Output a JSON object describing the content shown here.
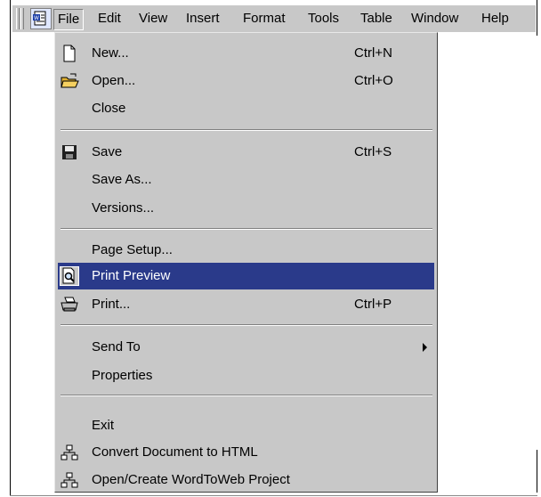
{
  "menubar": {
    "items": [
      "File",
      "Edit",
      "View",
      "Insert",
      "Format",
      "Tools",
      "Table",
      "Window",
      "Help"
    ],
    "active": "File"
  },
  "file_menu": {
    "new": {
      "label": "New...",
      "shortcut": "Ctrl+N",
      "icon": "new-document-icon"
    },
    "open": {
      "label": "Open...",
      "shortcut": "Ctrl+O",
      "icon": "open-folder-icon"
    },
    "close": {
      "label": "Close"
    },
    "save": {
      "label": "Save",
      "shortcut": "Ctrl+S",
      "icon": "floppy-disk-icon"
    },
    "save_as": {
      "label": "Save As..."
    },
    "versions": {
      "label": "Versions..."
    },
    "page_setup": {
      "label": "Page Setup..."
    },
    "print_preview": {
      "label": "Print Preview",
      "icon": "print-preview-icon",
      "highlighted": true
    },
    "print": {
      "label": "Print...",
      "shortcut": "Ctrl+P",
      "icon": "printer-icon"
    },
    "send_to": {
      "label": "Send To"
    },
    "properties": {
      "label": "Properties"
    },
    "exit": {
      "label": "Exit"
    },
    "convert_html": {
      "label": "Convert Document to HTML",
      "icon": "network-icon"
    },
    "wordtoweb": {
      "label": "Open/Create WordToWeb Project",
      "icon": "network-icon"
    }
  },
  "colors": {
    "menu_bg": "#c8c8c8",
    "highlight": "#2a3a8a"
  }
}
